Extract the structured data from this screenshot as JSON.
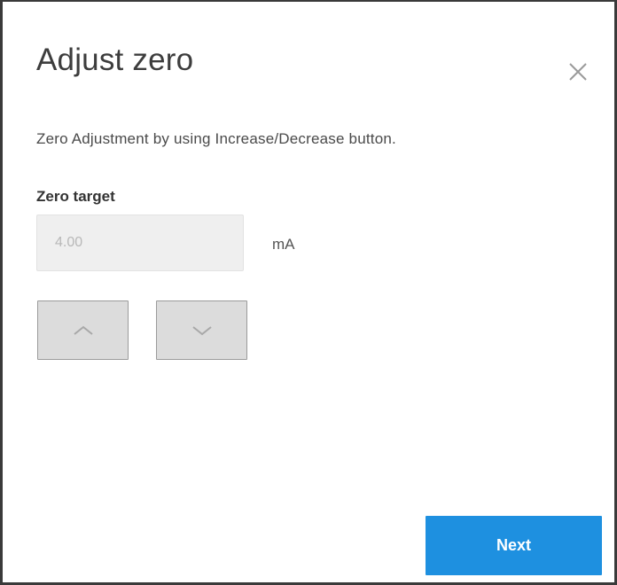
{
  "dialog": {
    "title": "Adjust zero",
    "close_icon": "close-icon",
    "description": "Zero Adjustment by using Increase/Decrease button."
  },
  "zero_target": {
    "label": "Zero target",
    "value": "4.00",
    "unit": "mA"
  },
  "stepper": {
    "increase_icon": "chevron-up-icon",
    "decrease_icon": "chevron-down-icon"
  },
  "actions": {
    "next_label": "Next"
  },
  "colors": {
    "primary": "#1e90e0",
    "input_background": "#efefef",
    "stepper_background": "#dcdcdc"
  }
}
